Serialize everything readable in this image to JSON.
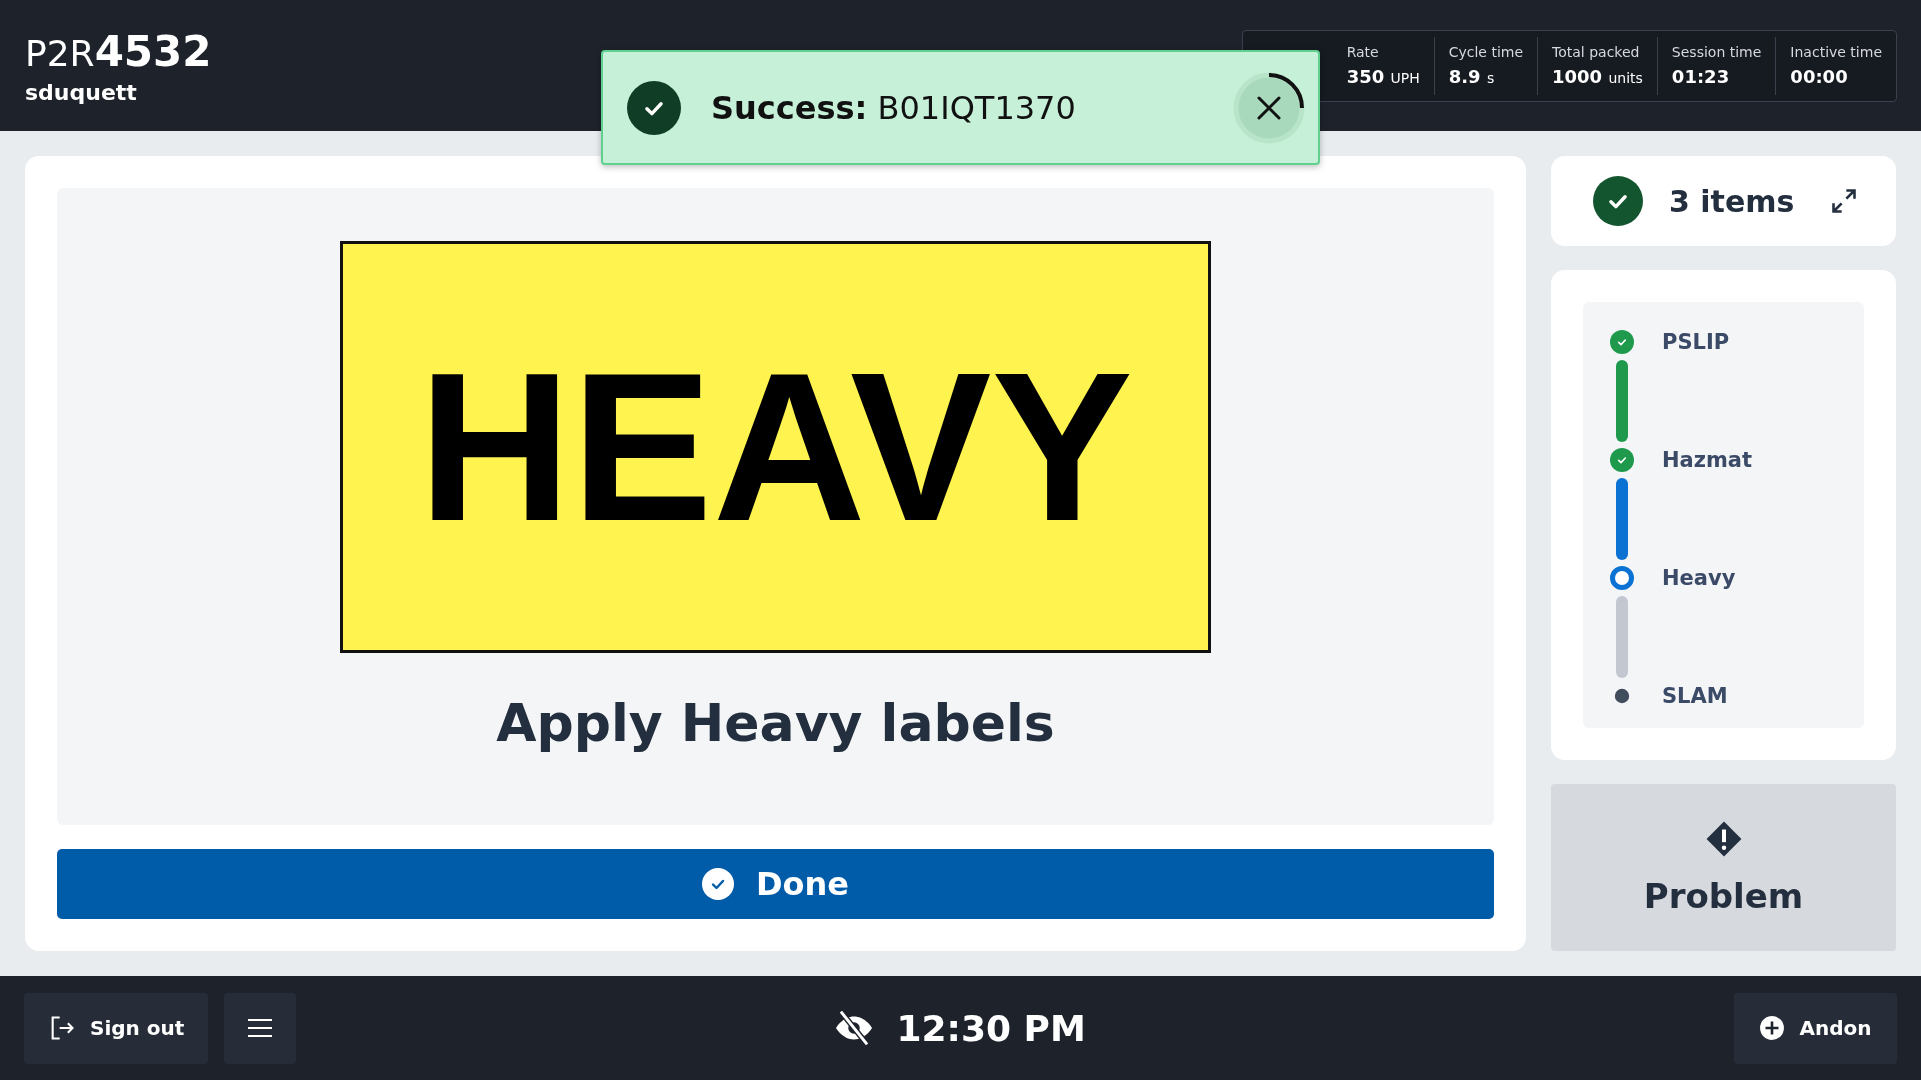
{
  "header": {
    "station_prefix": "P2R",
    "station_number": "4532",
    "user": "sduquett",
    "stats": [
      {
        "label": "Rate",
        "value": "350",
        "unit": "UPH"
      },
      {
        "label": "Cycle time",
        "value": "8.9",
        "unit": "s"
      },
      {
        "label": "Total packed",
        "value": "1000",
        "unit": "units"
      },
      {
        "label": "Session time",
        "value": "01:23"
      },
      {
        "label": "Inactive time",
        "value": "00:00"
      }
    ]
  },
  "toast": {
    "kind": "success",
    "message": "**Success:** B01IQT1370"
  },
  "task": {
    "label_text": "HEAVY",
    "instruction": "Apply Heavy labels",
    "button": "Done"
  },
  "items_summary": {
    "count": "3 items"
  },
  "steps": [
    {
      "label": "PSLIP",
      "completed": true,
      "selected": false
    },
    {
      "label": "Hazmat",
      "completed": true,
      "selected": false
    },
    {
      "label": "Heavy",
      "completed": false,
      "selected": true
    },
    {
      "label": "SLAM",
      "completed": false,
      "selected": false
    }
  ],
  "problem_button": "Problem",
  "footer": {
    "sign_out": "Sign out",
    "time": "12:30 PM",
    "andon": "Andon"
  }
}
